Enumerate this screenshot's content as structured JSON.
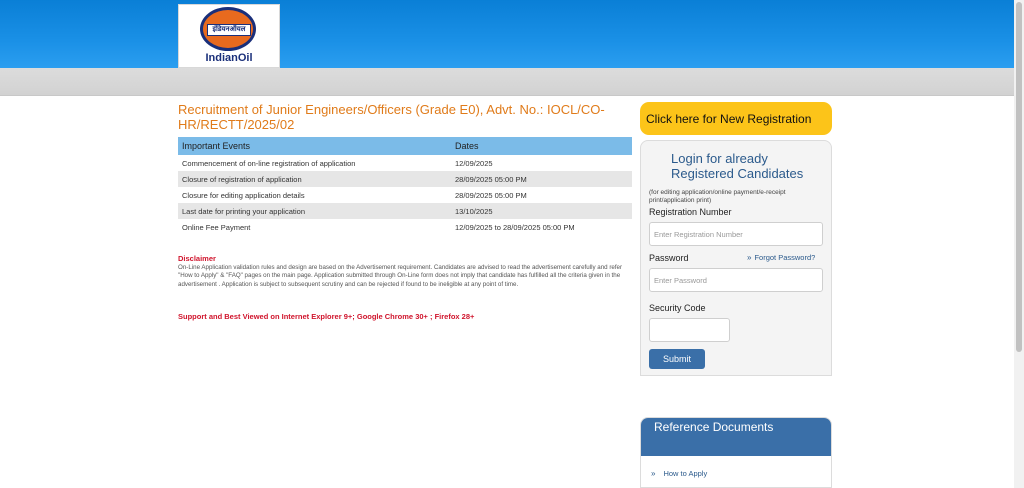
{
  "header": {
    "logo_hindi": "इंडियनऑयल",
    "logo_text": "IndianOil",
    "logo_colors": {
      "orange": "#e86a1e",
      "navy": "#1a2f7a"
    },
    "bar_color": "#1a90e6"
  },
  "page": {
    "title": "Recruitment of Junior Engineers/Officers (Grade E0), Advt. No.: IOCL/CO-HR/RECTT/2025/02"
  },
  "events_table": {
    "headers": [
      "Important Events",
      "Dates"
    ],
    "rows": [
      [
        "Commencement of on-line registration of application",
        "12/09/2025"
      ],
      [
        "Closure of registration of application",
        "28/09/2025 05:00 PM"
      ],
      [
        "Closure for editing application details",
        "28/09/2025 05:00 PM"
      ],
      [
        "Last date for printing your application",
        "13/10/2025"
      ],
      [
        "Online Fee Payment",
        "12/09/2025 to 28/09/2025 05:00 PM"
      ]
    ]
  },
  "disclaimer": {
    "heading": "Disclaimer",
    "text": "On-Line Application validation rules and design are based on the Advertisement requirement. Candidates are advised to read the advertisement carefully and refer \"How to Apply\" & \"FAQ\" pages on the main page. Application submitted through On-Line form does not imply that candidate has fulfilled all the criteria given in the advertisement . Application is subject to subsequent scrutiny and can be rejected if found to be ineligible at any point of time."
  },
  "support_text": "Support and Best Viewed on Internet Explorer 9+; Google Chrome 30+ ; Firefox 28+",
  "new_registration": {
    "label": "Click here for New Registration",
    "color": "#fcc419"
  },
  "login": {
    "heading": "Login for already Registered Candidates",
    "note": "(for editing application/online payment/e-receipt print/application print)",
    "reg_label": "Registration Number",
    "reg_placeholder": "Enter Registration Number",
    "password_label": "Password",
    "password_placeholder": "Enter Password",
    "forgot_label": "Forgot Password?",
    "forgot_icon": "double-chevron-right-icon",
    "security_label": "Security Code",
    "submit_label": "Submit",
    "accent": "#3a6fa8"
  },
  "reference": {
    "heading": "Reference Documents",
    "items": [
      {
        "label": "How to Apply",
        "icon": "double-chevron-right-icon"
      }
    ]
  }
}
